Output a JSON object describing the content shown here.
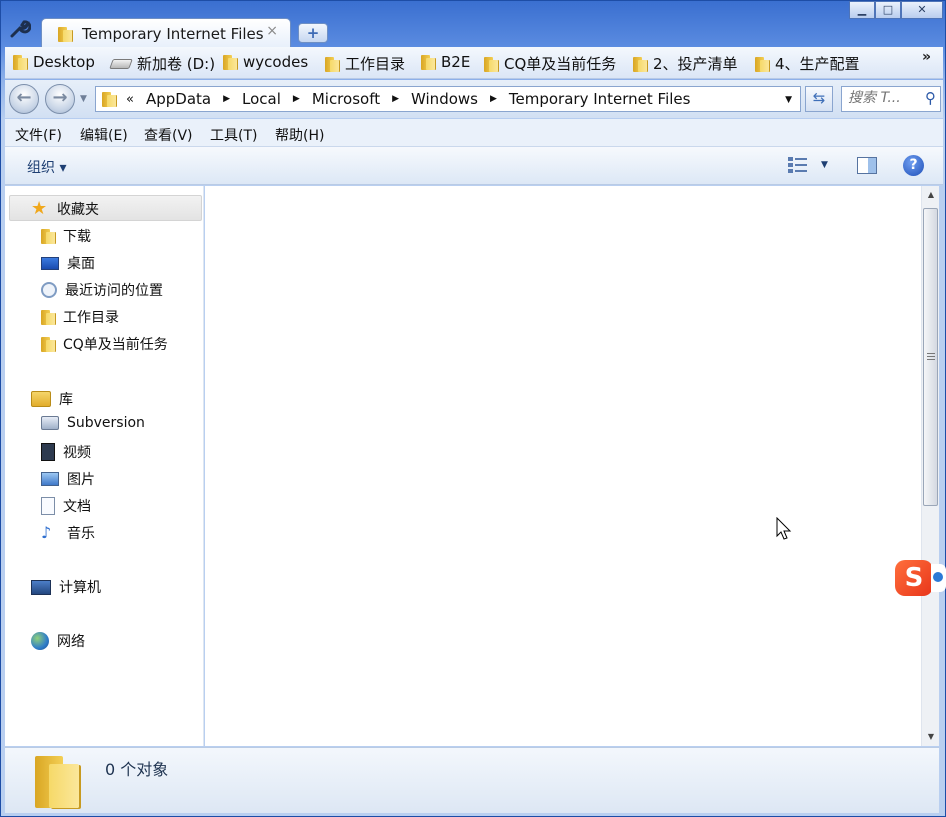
{
  "tab": {
    "title": "Temporary Internet Files",
    "close": "×",
    "new_tab": "+"
  },
  "window_buttons": {
    "minimize": "▁",
    "maximize": "□",
    "close": "✕"
  },
  "favorites": [
    {
      "label": "Desktop",
      "icon": "folder-icon"
    },
    {
      "label": "新加卷 (D:)",
      "icon": "drive-icon"
    },
    {
      "label": "wycodes",
      "icon": "folder-icon"
    },
    {
      "label": "工作目录",
      "icon": "folder-icon"
    },
    {
      "label": "B2E",
      "icon": "folder-icon"
    },
    {
      "label": "CQ单及当前任务",
      "icon": "folder-icon"
    },
    {
      "label": "2、投产清单",
      "icon": "folder-icon"
    },
    {
      "label": "4、生产配置",
      "icon": "folder-icon"
    }
  ],
  "favorites_more": "»",
  "address": {
    "lead": "«",
    "crumbs": [
      "AppData",
      "Local",
      "Microsoft",
      "Windows",
      "Temporary Internet Files"
    ]
  },
  "search": {
    "placeholder": "搜索 T..."
  },
  "menu": [
    "文件(F)",
    "编辑(E)",
    "查看(V)",
    "工具(T)",
    "帮助(H)"
  ],
  "command_bar": {
    "organize": "组织 ▾",
    "help": "?"
  },
  "nav_pane": {
    "favorites_header": "收藏夹",
    "favorites": [
      {
        "label": "下载",
        "icon": "download-folder-icon"
      },
      {
        "label": "桌面",
        "icon": "desktop-icon"
      },
      {
        "label": "最近访问的位置",
        "icon": "recent-places-icon"
      },
      {
        "label": "工作目录",
        "icon": "folder-icon"
      },
      {
        "label": "CQ单及当前任务",
        "icon": "folder-icon"
      }
    ],
    "libraries_header": "库",
    "libraries": [
      {
        "label": "Subversion",
        "icon": "subversion-icon"
      },
      {
        "label": "视频",
        "icon": "video-library-icon"
      },
      {
        "label": "图片",
        "icon": "pictures-library-icon"
      },
      {
        "label": "文档",
        "icon": "documents-library-icon"
      },
      {
        "label": "音乐",
        "icon": "music-library-icon"
      }
    ],
    "computer": "计算机",
    "network": "网络"
  },
  "details": {
    "item_count": "0 个对象"
  },
  "ime_badge": "S"
}
